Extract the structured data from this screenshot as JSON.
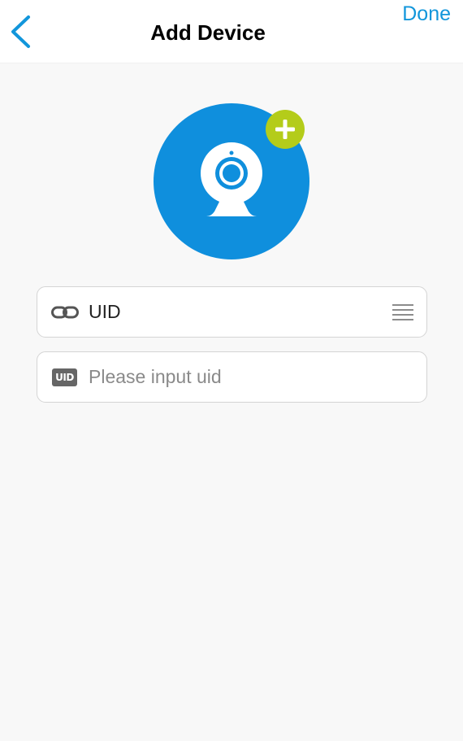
{
  "header": {
    "title": "Add Device",
    "done_label": "Done"
  },
  "form": {
    "uid_type_label": "UID",
    "uid_input_placeholder": "Please input uid",
    "uid_input_value": "",
    "uid_badge_text": "UID"
  },
  "colors": {
    "accent": "#1296db",
    "device_circle": "#0f8fdd",
    "add_badge": "#b4cc1a",
    "field_border": "#d4d4d4",
    "page_background": "#f8f8f8"
  },
  "icons": {
    "back": "chevron-left-icon",
    "device": "webcam-icon",
    "add": "plus-circle-icon",
    "link": "link-icon",
    "menu": "list-lines-icon",
    "uid": "uid-badge-icon"
  }
}
